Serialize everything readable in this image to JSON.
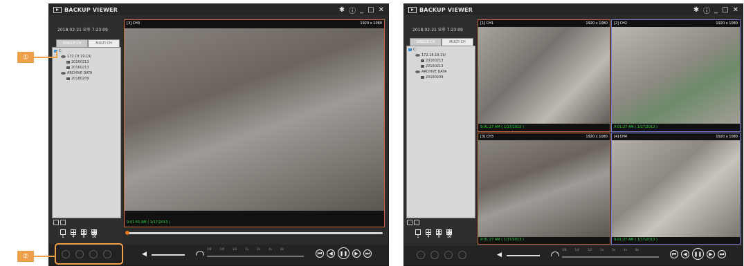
{
  "left_window": {
    "title": "BACKUP VIEWER",
    "datetime": "2018-02-21 오후 7:23:09",
    "tabs": [
      "SINGLE CH",
      "MULTI CH"
    ],
    "tree": [
      "C:",
      "172.18.19.19/",
      "20160213",
      "20160213",
      "ARCHIVE DATA",
      "20180209"
    ],
    "layout_labels": [
      "1",
      "4",
      "9",
      "16"
    ],
    "video": {
      "channel_label": "[3] CH3",
      "resolution": "1920 x 1080",
      "timestamp": "9:01:55 AM ( 1/17/2013 )"
    },
    "speed_labels": [
      "1/8",
      "1/4",
      "1/2",
      "1x",
      "2x",
      "4x",
      "8x"
    ]
  },
  "right_window": {
    "title": "BACKUP VIEWER",
    "datetime": "2018-02-21 오후 7:23:09",
    "tabs": [
      "SINGLE CH",
      "MULTI CH"
    ],
    "tree": [
      "C:",
      "172.18.19.19/",
      "20160213",
      "20160213",
      "ARCHIVE DATA",
      "20180209"
    ],
    "layout_labels": [
      "1",
      "4",
      "9",
      "16"
    ],
    "channels": [
      {
        "label": "[1] CH1",
        "resolution": "1920 x 1080",
        "timestamp": "9:01:27 AM ( 1/17/2013 )"
      },
      {
        "label": "[2] CH2",
        "resolution": "1920 x 1080",
        "timestamp": "9:01:27 AM ( 1/17/2013 )"
      },
      {
        "label": "[3] CH3",
        "resolution": "1920 x 1080",
        "timestamp": "9:01:27 AM ( 1/17/2013 )"
      },
      {
        "label": "[4] CH4",
        "resolution": "1920 x 1080",
        "timestamp": "9:01:27 AM ( 1/17/2013 )"
      }
    ],
    "speed_labels": [
      "1/8",
      "1/4",
      "1/2",
      "1x",
      "2x",
      "4x",
      "8x"
    ]
  },
  "callouts": [
    "①",
    "②"
  ],
  "colors": {
    "accent": "#f0a04b",
    "timestamp": "#2fd64b",
    "window": "#2b2b2b"
  }
}
